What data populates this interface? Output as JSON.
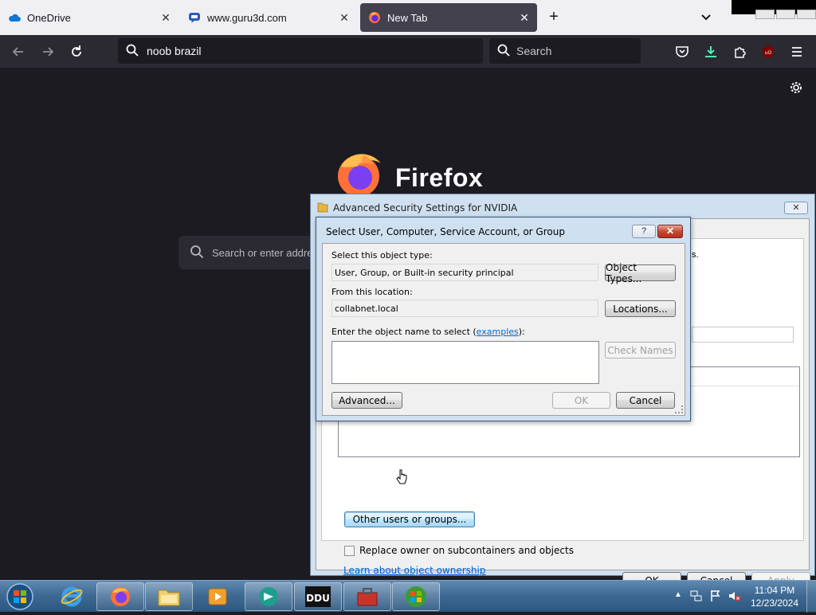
{
  "browser": {
    "tabs": [
      {
        "label": "OneDrive",
        "icon": "onedrive-cloud-icon",
        "active": false
      },
      {
        "label": "www.guru3d.com",
        "icon": "guru3d-icon",
        "active": false
      },
      {
        "label": "New Tab",
        "icon": "firefox-icon",
        "active": true
      }
    ],
    "url_value": "noob brazil",
    "search_placeholder": "Search",
    "new_tab": {
      "wordmark": "Firefox",
      "search_placeholder": "Search or enter address"
    }
  },
  "advanced_security_dialog": {
    "title": "Advanced Security Settings for NVIDIA",
    "fragment_text": "s.",
    "other_users_button": "Other users or groups...",
    "replace_owner_checkbox": {
      "label": "Replace owner on subcontainers and objects",
      "checked": false
    },
    "learn_link": "Learn about object ownership",
    "buttons": {
      "ok": "OK",
      "cancel": "Cancel",
      "apply": "Apply"
    }
  },
  "select_user_dialog": {
    "title": "Select User, Computer, Service Account, or Group",
    "help_label": "?",
    "object_type_label": "Select this object type:",
    "object_type_value": "User, Group, or Built-in security principal",
    "object_types_button": "Object Types...",
    "location_label": "From this location:",
    "location_value": "collabnet.local",
    "locations_button": "Locations...",
    "names_label_prefix": "Enter the object name to select (",
    "names_label_link": "examples",
    "names_label_suffix": "):",
    "names_value": "",
    "check_names_button": "Check Names",
    "advanced_button": "Advanced...",
    "ok_button": "OK",
    "cancel_button": "Cancel"
  },
  "taskbar": {
    "pinned": [
      "internet-explorer",
      "firefox",
      "windows-explorer",
      "media-player",
      "app-teal",
      "ddu",
      "toolbox",
      "windows-update"
    ],
    "clock_time": "11:04 PM",
    "clock_date": "12/23/2024"
  },
  "colors": {
    "browser_dark": "#1c1b22",
    "toolbar": "#2b2a33",
    "dialog_frame": "#cfe0f1",
    "link": "#0066cc",
    "taskbar": "#3f6a94"
  }
}
